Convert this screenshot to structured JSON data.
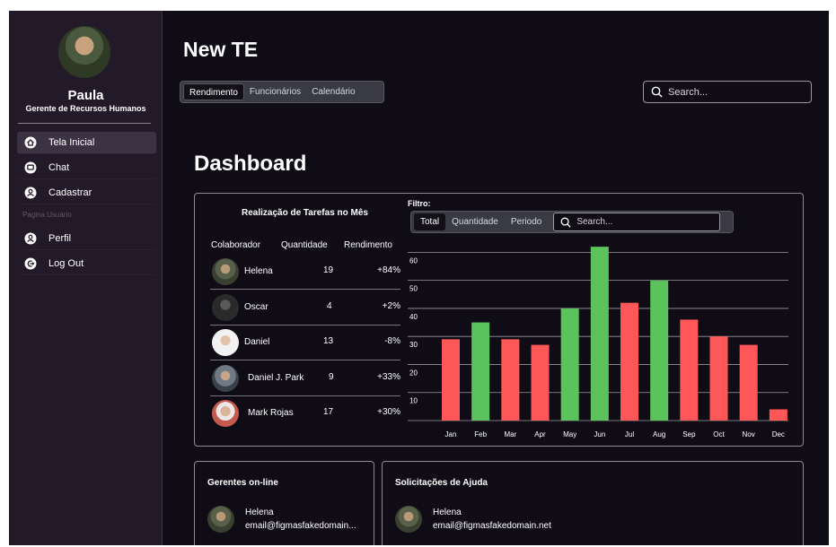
{
  "app": {
    "title": "New TE"
  },
  "user": {
    "name": "Paula",
    "role": "Gerente de Recursos Humanos"
  },
  "sidebar": {
    "items": [
      {
        "label": "Tela Inicial",
        "icon": "home-icon",
        "active": true
      },
      {
        "label": "Chat",
        "icon": "chat-icon",
        "active": false
      },
      {
        "label": "Cadastrar",
        "icon": "user-add-icon",
        "active": false
      }
    ],
    "section_label": "Pagina Usuário",
    "user_items": [
      {
        "label": "Perfil",
        "icon": "profile-icon"
      },
      {
        "label": "Log Out",
        "icon": "logout-icon"
      }
    ]
  },
  "header": {
    "tabs": [
      {
        "label": "Rendimento",
        "active": true
      },
      {
        "label": "Funcionários",
        "active": false
      },
      {
        "label": "Calendário",
        "active": false
      }
    ],
    "search_placeholder": "Search..."
  },
  "dashboard": {
    "title": "Dashboard",
    "performance": {
      "title": "Realização de Tarefas no Mês",
      "columns": [
        "Colaborador",
        "Quantidade",
        "Rendimento"
      ],
      "rows": [
        {
          "name": "Helena",
          "quantity": "19",
          "performance": "+84%"
        },
        {
          "name": "Oscar",
          "quantity": "4",
          "performance": "+2%"
        },
        {
          "name": "Daniel",
          "quantity": "13",
          "performance": "-8%"
        },
        {
          "name": "Daniel J. Park",
          "quantity": "9",
          "performance": "+33%"
        },
        {
          "name": "Mark Rojas",
          "quantity": "17",
          "performance": "+30%"
        }
      ]
    },
    "filter": {
      "label": "Filtro:",
      "tabs": [
        {
          "label": "Total",
          "active": true
        },
        {
          "label": "Quantidade",
          "active": false
        },
        {
          "label": "Periodo",
          "active": false
        }
      ],
      "search_placeholder": "Search..."
    }
  },
  "chart_data": {
    "type": "bar",
    "categories": [
      "Jan",
      "Feb",
      "Mar",
      "Apr",
      "May",
      "Jun",
      "Jul",
      "Aug",
      "Sep",
      "Oct",
      "Nov",
      "Dec"
    ],
    "values": [
      29,
      35,
      29,
      27,
      40,
      62,
      42,
      50,
      36,
      30,
      27,
      4
    ],
    "bar_colors": [
      "#ff5757",
      "#5cc35c",
      "#ff5757",
      "#ff5757",
      "#5cc35c",
      "#5cc35c",
      "#ff5757",
      "#5cc35c",
      "#ff5757",
      "#ff5757",
      "#ff5757",
      "#ff5757"
    ],
    "yticks": [
      10,
      20,
      30,
      40,
      50,
      60
    ],
    "ylim": [
      0,
      63
    ],
    "grid": true,
    "title": "",
    "xlabel": "",
    "ylabel": ""
  },
  "bottom": {
    "managers": {
      "title": "Gerentes on-line",
      "name": "Helena",
      "email": "email@figmasfakedomain..."
    },
    "help": {
      "title": "Solicitações de Ajuda",
      "name": "Helena",
      "email": "email@figmasfakedomain.net"
    }
  },
  "colors": {
    "background": "#100c15",
    "sidebar": "#221a29",
    "bar_red": "#ff5757",
    "bar_green": "#5cc35c"
  }
}
